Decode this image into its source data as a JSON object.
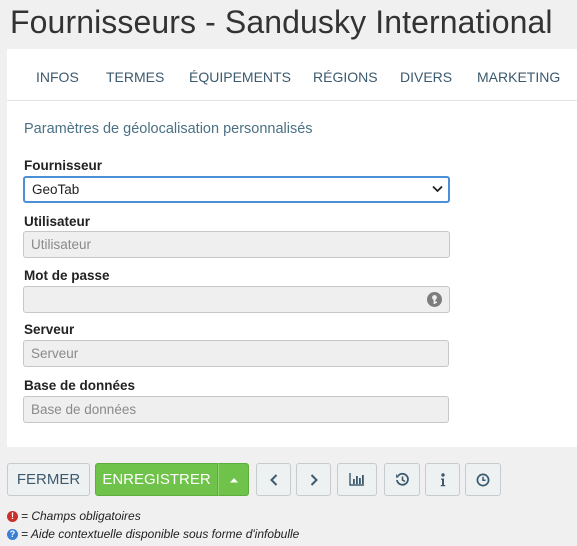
{
  "page": {
    "title": "Fournisseurs - Sandusky International"
  },
  "tabs": [
    "INFOS",
    "TERMES",
    "ÉQUIPEMENTS",
    "RÉGIONS",
    "DIVERS",
    "MARKETING"
  ],
  "section": {
    "title": "Paramètres de géolocalisation personnalisés"
  },
  "form": {
    "fournisseur": {
      "label": "Fournisseur",
      "value": "GeoTab"
    },
    "utilisateur": {
      "label": "Utilisateur",
      "value": "",
      "placeholder": "Utilisateur"
    },
    "mot_de_passe": {
      "label": "Mot de passe",
      "value": "",
      "placeholder": ""
    },
    "serveur": {
      "label": "Serveur",
      "value": "",
      "placeholder": "Serveur"
    },
    "base_de_donnees": {
      "label": "Base de données",
      "value": "",
      "placeholder": "Base de données"
    }
  },
  "toolbar": {
    "close_label": "FERMER",
    "save_label": "ENREGISTRER",
    "icons": [
      "caret-up-icon",
      "chevron-left-icon",
      "chevron-right-icon",
      "bar-chart-icon",
      "history-icon",
      "info-icon",
      "clock-icon"
    ]
  },
  "legend": {
    "required_text": "= Champs obligatoires",
    "help_text": "= Aide contextuelle disponible sous forme d'infobulle"
  },
  "colors": {
    "accent_green": "#6fc24a",
    "focus_blue": "#4d8fd6",
    "tab_text": "#3c5a6e",
    "required_red": "#c9302c",
    "help_blue": "#3a7fd5"
  }
}
